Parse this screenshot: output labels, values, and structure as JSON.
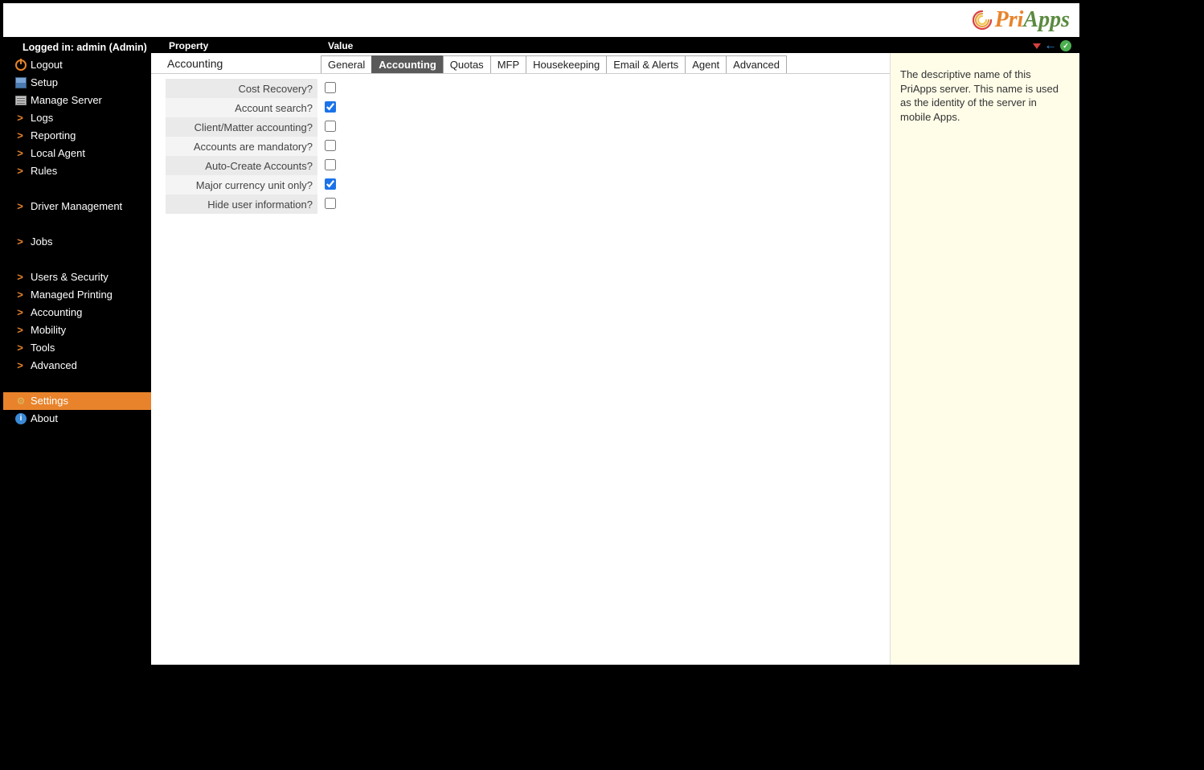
{
  "login_status": "Logged in: admin (Admin)",
  "header": {
    "property": "Property",
    "value": "Value"
  },
  "logo": {
    "pri": "Pri",
    "apps": "Apps"
  },
  "sidebar": [
    {
      "group": 0,
      "icon": "power",
      "label": "Logout"
    },
    {
      "group": 0,
      "icon": "setup",
      "label": "Setup"
    },
    {
      "group": 0,
      "icon": "server",
      "label": "Manage Server"
    },
    {
      "group": 0,
      "icon": "chevron",
      "label": "Logs"
    },
    {
      "group": 0,
      "icon": "chevron",
      "label": "Reporting"
    },
    {
      "group": 0,
      "icon": "chevron",
      "label": "Local Agent"
    },
    {
      "group": 0,
      "icon": "chevron",
      "label": "Rules"
    },
    {
      "group": 1,
      "icon": "chevron",
      "label": "Driver Management"
    },
    {
      "group": 2,
      "icon": "chevron",
      "label": "Jobs"
    },
    {
      "group": 3,
      "icon": "chevron",
      "label": "Users & Security"
    },
    {
      "group": 3,
      "icon": "chevron",
      "label": "Managed Printing"
    },
    {
      "group": 3,
      "icon": "chevron",
      "label": "Accounting"
    },
    {
      "group": 3,
      "icon": "chevron",
      "label": "Mobility"
    },
    {
      "group": 3,
      "icon": "chevron",
      "label": "Tools"
    },
    {
      "group": 3,
      "icon": "chevron",
      "label": "Advanced"
    },
    {
      "group": 4,
      "icon": "gears",
      "label": "Settings",
      "selected": true
    },
    {
      "group": 4,
      "icon": "info",
      "label": "About"
    }
  ],
  "section_title": "Accounting",
  "tabs": [
    {
      "label": "General",
      "active": false
    },
    {
      "label": "Accounting",
      "active": true
    },
    {
      "label": "Quotas",
      "active": false
    },
    {
      "label": "MFP",
      "active": false
    },
    {
      "label": "Housekeeping",
      "active": false
    },
    {
      "label": "Email & Alerts",
      "active": false
    },
    {
      "label": "Agent",
      "active": false
    },
    {
      "label": "Advanced",
      "active": false
    }
  ],
  "properties": [
    {
      "label": "Cost Recovery?",
      "checked": false
    },
    {
      "label": "Account search?",
      "checked": true
    },
    {
      "label": "Client/Matter accounting?",
      "checked": false
    },
    {
      "label": "Accounts are mandatory?",
      "checked": false
    },
    {
      "label": "Auto-Create Accounts?",
      "checked": false
    },
    {
      "label": "Major currency unit only?",
      "checked": true
    },
    {
      "label": "Hide user information?",
      "checked": false
    }
  ],
  "info_panel": "The descriptive name of this PriApps server. This name is used as the identity of the server in mobile Apps."
}
